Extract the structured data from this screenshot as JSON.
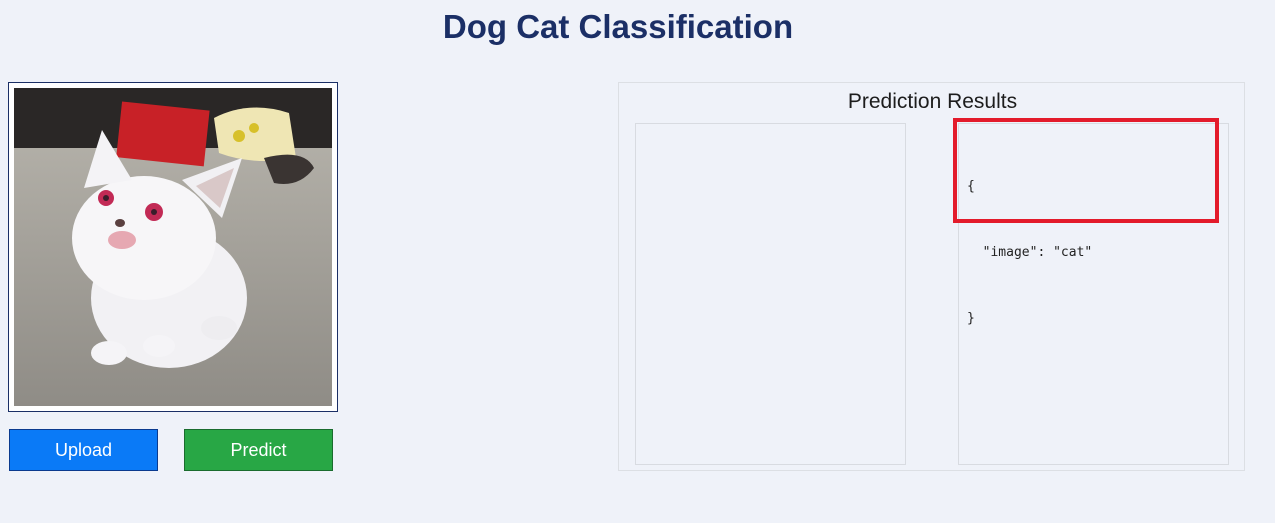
{
  "header": {
    "title": "Dog Cat Classification"
  },
  "preview": {
    "icon": "kitten-photo"
  },
  "buttons": {
    "upload_label": "Upload",
    "predict_label": "Predict"
  },
  "results": {
    "title": "Prediction Results",
    "json_lines": [
      "{",
      "  \"image\": \"cat\"",
      "}"
    ]
  },
  "colors": {
    "title": "#1b2f66",
    "upload": "#0a7af7",
    "predict": "#28a745",
    "highlight": "#e31b2b",
    "background": "#eff2f9"
  }
}
